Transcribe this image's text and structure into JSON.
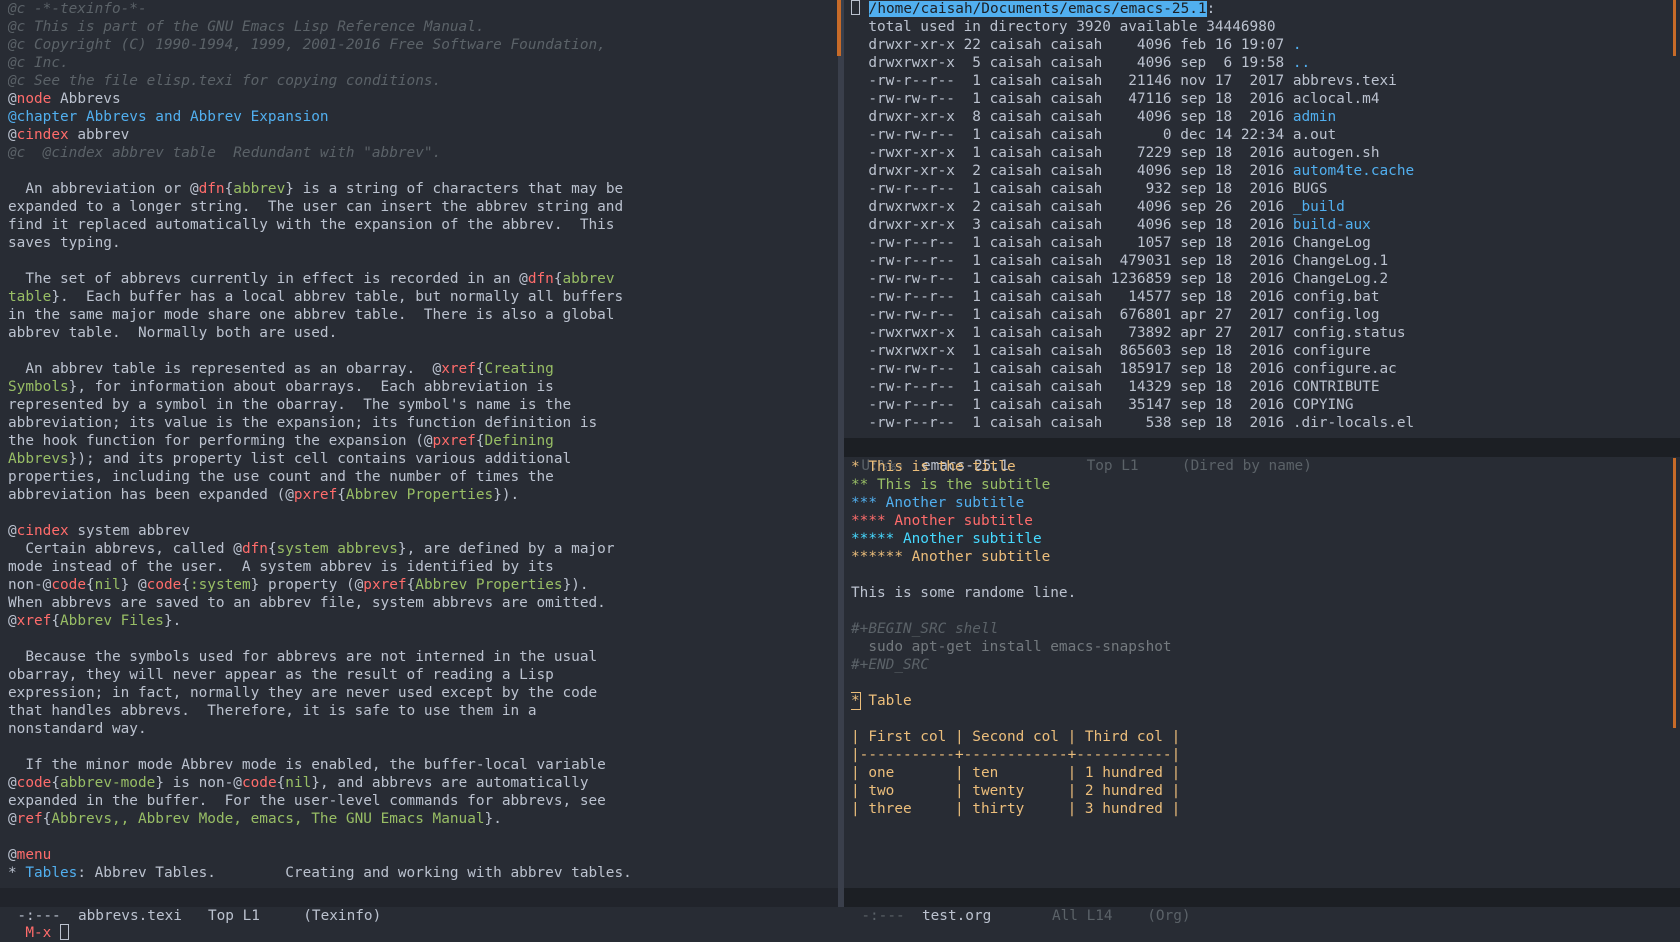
{
  "left_pane": {
    "lines": [
      [
        {
          "t": "@c -*-texinfo-*-",
          "c": "comment"
        }
      ],
      [
        {
          "t": "@c This is part of the GNU Emacs Lisp Reference Manual.",
          "c": "comment"
        }
      ],
      [
        {
          "t": "@c Copyright (C) 1990-1994, 1999, 2001-2016 Free Software Foundation,",
          "c": "comment"
        }
      ],
      [
        {
          "t": "@c Inc.",
          "c": "comment"
        }
      ],
      [
        {
          "t": "@c See the file elisp.texi for copying conditions.",
          "c": "comment"
        }
      ],
      [
        {
          "t": "@"
        },
        {
          "t": "node",
          "c": "kw"
        },
        {
          "t": " Abbrevs"
        }
      ],
      [
        {
          "t": "@chapter Abbrevs and Abbrev Expansion",
          "c": "chap"
        }
      ],
      [
        {
          "t": "@"
        },
        {
          "t": "cindex",
          "c": "kw"
        },
        {
          "t": " abbrev"
        }
      ],
      [
        {
          "t": "@c  @cindex abbrev table  Redundant with \"abbrev\".",
          "c": "comment"
        }
      ],
      [
        {
          "t": ""
        }
      ],
      [
        {
          "t": "  An abbreviation or @"
        },
        {
          "t": "dfn",
          "c": "kw"
        },
        {
          "t": "{"
        },
        {
          "t": "abbrev",
          "c": "arg"
        },
        {
          "t": "} is a string of characters that may be"
        }
      ],
      [
        {
          "t": "expanded to a longer string.  The user can insert the abbrev string and"
        }
      ],
      [
        {
          "t": "find it replaced automatically with the expansion of the abbrev.  This"
        }
      ],
      [
        {
          "t": "saves typing."
        }
      ],
      [
        {
          "t": ""
        }
      ],
      [
        {
          "t": "  The set of abbrevs currently in effect is recorded in an @"
        },
        {
          "t": "dfn",
          "c": "kw"
        },
        {
          "t": "{"
        },
        {
          "t": "abbrev",
          "c": "arg"
        }
      ],
      [
        {
          "t": "table",
          "c": "arg"
        },
        {
          "t": "}.  Each buffer has a local abbrev table, but normally all buffers"
        }
      ],
      [
        {
          "t": "in the same major mode share one abbrev table.  There is also a global"
        }
      ],
      [
        {
          "t": "abbrev table.  Normally both are used."
        }
      ],
      [
        {
          "t": ""
        }
      ],
      [
        {
          "t": "  An abbrev table is represented as an obarray.  @"
        },
        {
          "t": "xref",
          "c": "kw"
        },
        {
          "t": "{"
        },
        {
          "t": "Creating",
          "c": "arg"
        }
      ],
      [
        {
          "t": "Symbols",
          "c": "arg"
        },
        {
          "t": "}, for information about obarrays.  Each abbreviation is"
        }
      ],
      [
        {
          "t": "represented by a symbol in the obarray.  The symbol's name is the"
        }
      ],
      [
        {
          "t": "abbreviation; its value is the expansion; its function definition is"
        }
      ],
      [
        {
          "t": "the hook function for performing the expansion (@"
        },
        {
          "t": "pxref",
          "c": "kw"
        },
        {
          "t": "{"
        },
        {
          "t": "Defining",
          "c": "arg"
        }
      ],
      [
        {
          "t": "Abbrevs",
          "c": "arg"
        },
        {
          "t": "}); and its property list cell contains various additional"
        }
      ],
      [
        {
          "t": "properties, including the use count and the number of times the"
        }
      ],
      [
        {
          "t": "abbreviation has been expanded (@"
        },
        {
          "t": "pxref",
          "c": "kw"
        },
        {
          "t": "{"
        },
        {
          "t": "Abbrev Properties",
          "c": "arg"
        },
        {
          "t": "})."
        }
      ],
      [
        {
          "t": ""
        }
      ],
      [
        {
          "t": "@"
        },
        {
          "t": "cindex",
          "c": "kw"
        },
        {
          "t": " system abbrev"
        }
      ],
      [
        {
          "t": "  Certain abbrevs, called @"
        },
        {
          "t": "dfn",
          "c": "kw"
        },
        {
          "t": "{"
        },
        {
          "t": "system abbrevs",
          "c": "arg"
        },
        {
          "t": "}, are defined by a major"
        }
      ],
      [
        {
          "t": "mode instead of the user.  A system abbrev is identified by its"
        }
      ],
      [
        {
          "t": "non-@"
        },
        {
          "t": "code",
          "c": "kw"
        },
        {
          "t": "{"
        },
        {
          "t": "nil",
          "c": "arg"
        },
        {
          "t": "} @"
        },
        {
          "t": "code",
          "c": "kw"
        },
        {
          "t": "{"
        },
        {
          "t": ":system",
          "c": "arg"
        },
        {
          "t": "} property (@"
        },
        {
          "t": "pxref",
          "c": "kw"
        },
        {
          "t": "{"
        },
        {
          "t": "Abbrev Properties",
          "c": "arg"
        },
        {
          "t": "})."
        }
      ],
      [
        {
          "t": "When abbrevs are saved to an abbrev file, system abbrevs are omitted."
        }
      ],
      [
        {
          "t": "@"
        },
        {
          "t": "xref",
          "c": "kw"
        },
        {
          "t": "{"
        },
        {
          "t": "Abbrev Files",
          "c": "arg"
        },
        {
          "t": "}."
        }
      ],
      [
        {
          "t": ""
        }
      ],
      [
        {
          "t": "  Because the symbols used for abbrevs are not interned in the usual"
        }
      ],
      [
        {
          "t": "obarray, they will never appear as the result of reading a Lisp"
        }
      ],
      [
        {
          "t": "expression; in fact, normally they are never used except by the code"
        }
      ],
      [
        {
          "t": "that handles abbrevs.  Therefore, it is safe to use them in a"
        }
      ],
      [
        {
          "t": "nonstandard way."
        }
      ],
      [
        {
          "t": ""
        }
      ],
      [
        {
          "t": "  If the minor mode Abbrev mode is enabled, the buffer-local variable"
        }
      ],
      [
        {
          "t": "@"
        },
        {
          "t": "code",
          "c": "kw"
        },
        {
          "t": "{"
        },
        {
          "t": "abbrev-mode",
          "c": "arg"
        },
        {
          "t": "} is non-@"
        },
        {
          "t": "code",
          "c": "kw"
        },
        {
          "t": "{"
        },
        {
          "t": "nil",
          "c": "arg"
        },
        {
          "t": "}, and abbrevs are automatically"
        }
      ],
      [
        {
          "t": "expanded in the buffer.  For the user-level commands for abbrevs, see"
        }
      ],
      [
        {
          "t": "@"
        },
        {
          "t": "ref",
          "c": "kw"
        },
        {
          "t": "{"
        },
        {
          "t": "Abbrevs,, Abbrev Mode, emacs, The GNU Emacs Manual",
          "c": "arg"
        },
        {
          "t": "}."
        }
      ],
      [
        {
          "t": ""
        }
      ],
      [
        {
          "t": "@"
        },
        {
          "t": "menu",
          "c": "kw"
        }
      ],
      [
        {
          "t": "* "
        },
        {
          "t": "Tables",
          "c": "menu-item"
        },
        {
          "t": ": Abbrev Tables.        Creating and working with abbrev tables."
        }
      ]
    ],
    "modeline": {
      "state": "-:---",
      "buffer": "abbrevs.texi",
      "position": "Top L1",
      "mode": "(Texinfo)"
    }
  },
  "dired_pane": {
    "path": "/home/caisah/Documents/emacs/emacs-25.1",
    "summary": "total used in directory 3920 available 34446980",
    "entries": [
      {
        "meta": "drwxr-xr-x 22 caisah caisah    4096 feb 16 19:07 ",
        "name": ".",
        "dir": true
      },
      {
        "meta": "drwxrwxr-x  5 caisah caisah    4096 sep  6 19:58 ",
        "name": "..",
        "dir": true
      },
      {
        "meta": "-rw-r--r--  1 caisah caisah   21146 nov 17  2017 ",
        "name": "abbrevs.texi",
        "dir": false
      },
      {
        "meta": "-rw-rw-r--  1 caisah caisah   47116 sep 18  2016 ",
        "name": "aclocal.m4",
        "dir": false
      },
      {
        "meta": "drwxr-xr-x  8 caisah caisah    4096 sep 18  2016 ",
        "name": "admin",
        "dir": true
      },
      {
        "meta": "-rw-rw-r--  1 caisah caisah       0 dec 14 22:34 ",
        "name": "a.out",
        "dir": false
      },
      {
        "meta": "-rwxr-xr-x  1 caisah caisah    7229 sep 18  2016 ",
        "name": "autogen.sh",
        "dir": false
      },
      {
        "meta": "drwxr-xr-x  2 caisah caisah    4096 sep 18  2016 ",
        "name": "autom4te.cache",
        "dir": true
      },
      {
        "meta": "-rw-r--r--  1 caisah caisah     932 sep 18  2016 ",
        "name": "BUGS",
        "dir": false
      },
      {
        "meta": "drwxrwxr-x  2 caisah caisah    4096 sep 26  2016 ",
        "name": "_build",
        "dir": true
      },
      {
        "meta": "drwxr-xr-x  3 caisah caisah    4096 sep 18  2016 ",
        "name": "build-aux",
        "dir": true
      },
      {
        "meta": "-rw-r--r--  1 caisah caisah    1057 sep 18  2016 ",
        "name": "ChangeLog",
        "dir": false
      },
      {
        "meta": "-rw-r--r--  1 caisah caisah  479031 sep 18  2016 ",
        "name": "ChangeLog.1",
        "dir": false
      },
      {
        "meta": "-rw-rw-r--  1 caisah caisah 1236859 sep 18  2016 ",
        "name": "ChangeLog.2",
        "dir": false
      },
      {
        "meta": "-rw-r--r--  1 caisah caisah   14577 sep 18  2016 ",
        "name": "config.bat",
        "dir": false
      },
      {
        "meta": "-rw-rw-r--  1 caisah caisah  676801 apr 27  2017 ",
        "name": "config.log",
        "dir": false
      },
      {
        "meta": "-rwxrwxr-x  1 caisah caisah   73892 apr 27  2017 ",
        "name": "config.status",
        "dir": false
      },
      {
        "meta": "-rwxrwxr-x  1 caisah caisah  865603 sep 18  2016 ",
        "name": "configure",
        "dir": false
      },
      {
        "meta": "-rw-rw-r--  1 caisah caisah  185917 sep 18  2016 ",
        "name": "configure.ac",
        "dir": false
      },
      {
        "meta": "-rw-r--r--  1 caisah caisah   14329 sep 18  2016 ",
        "name": "CONTRIBUTE",
        "dir": false
      },
      {
        "meta": "-rw-r--r--  1 caisah caisah   35147 sep 18  2016 ",
        "name": "COPYING",
        "dir": false
      },
      {
        "meta": "-rw-r--r--  1 caisah caisah     538 sep 18  2016 ",
        "name": ".dir-locals.el",
        "dir": false
      }
    ],
    "modeline": {
      "state": "U:%%-",
      "buffer": "emacs-25.1",
      "position": "Top L1",
      "mode": "(Dired by name)"
    }
  },
  "org_pane": {
    "headings": [
      {
        "text": "* This is the title",
        "level": "h1"
      },
      {
        "text": "** This is the subtitle",
        "level": "h2"
      },
      {
        "text": "*** Another subtitle",
        "level": "h3"
      },
      {
        "text": "**** Another subtitle",
        "level": "h4"
      },
      {
        "text": "***** Another subtitle",
        "level": "h5"
      },
      {
        "text": "****** Another subtitle",
        "level": "h6"
      }
    ],
    "body_line": "This is some randome line.",
    "src_begin": "#+BEGIN_SRC shell",
    "src_code": "  sudo apt-get install emacs-snapshot",
    "src_end": "#+END_SRC",
    "table_heading_star": "*",
    "table_heading_text": " Table",
    "table": {
      "header": [
        "First col",
        "Second col",
        "Third col"
      ],
      "rows": [
        [
          "one",
          "ten",
          "1 hundred"
        ],
        [
          "two",
          "twenty",
          "2 hundred"
        ],
        [
          "three",
          "thirty",
          "3 hundred"
        ]
      ]
    },
    "modeline": {
      "state": "-:---",
      "buffer": "test.org",
      "position": "All L14",
      "mode": "(Org)"
    }
  },
  "minibuffer": {
    "prompt": "M-x "
  },
  "colors": {
    "background": "#282c34",
    "modeline_active": "#21242b",
    "accent": "#51afef",
    "keyword": "#ff6c6b",
    "string": "#98be65",
    "heading": "#ecbe7b"
  }
}
